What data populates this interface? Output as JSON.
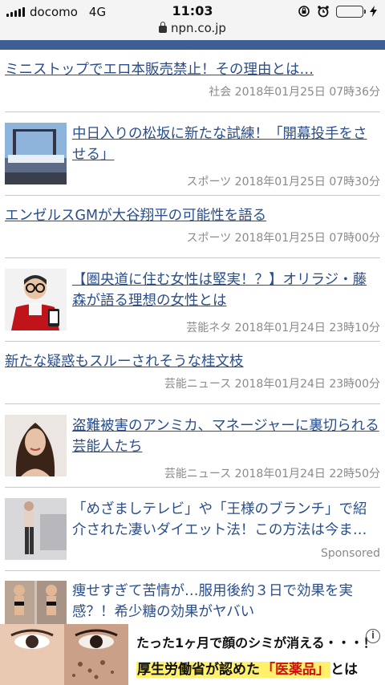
{
  "status": {
    "carrier": "docomo",
    "network": "4G",
    "time": "11:03",
    "url": "npn.co.jp"
  },
  "articles": [
    {
      "title": "ミニストップでエロ本販売禁止！その理由とは…",
      "category": "社会",
      "date": "2018年01月25日 07時36分",
      "thumb": null
    },
    {
      "title": "中日入りの松坂に新たな試練！「開幕投手をさせる」",
      "category": "スポーツ",
      "date": "2018年01月25日 07時30分",
      "thumb": "stadium"
    },
    {
      "title": "エンゼルスGMが大谷翔平の可能性を語る",
      "category": "スポーツ",
      "date": "2018年01月25日 07時00分",
      "thumb": null
    },
    {
      "title": "【圏央道に住む女性は堅実！？】オリラジ・藤森が語る理想の女性とは",
      "category": "芸能ネタ",
      "date": "2018年01月24日 23時10分",
      "thumb": "man-red-jacket"
    },
    {
      "title": "新たな疑惑もスルーされそうな桂文枝",
      "category": "芸能ニュース",
      "date": "2018年01月24日 23時00分",
      "thumb": null
    },
    {
      "title": "盗難被害のアンミカ、マネージャーに裏切られる芸能人たち",
      "category": "芸能ニュース",
      "date": "2018年01月24日 22時50分",
      "thumb": "woman-portrait"
    }
  ],
  "sponsored": [
    {
      "text": "「めざましテレビ」や「王様のブランチ」で紹介された凄いダイエット法！この方法は今ま…",
      "label": "Sponsored",
      "thumb": "diet-woman"
    },
    {
      "text": "痩せすぎて苦情が…服用後約３日で効果を実感？！希少糖の効果がヤバい",
      "thumb": "bikini-women"
    }
  ],
  "ad": {
    "line1": "たった1ヶ月で顔のシミが消える・・・！",
    "line2_a": "厚生労働省が認めた",
    "line2_b": "「医薬品」",
    "line2_c": "とは",
    "info": "i"
  },
  "colors": {
    "link": "#2a4e8c",
    "header_bar": "#3d5f93",
    "meta": "#8a8a8a"
  }
}
